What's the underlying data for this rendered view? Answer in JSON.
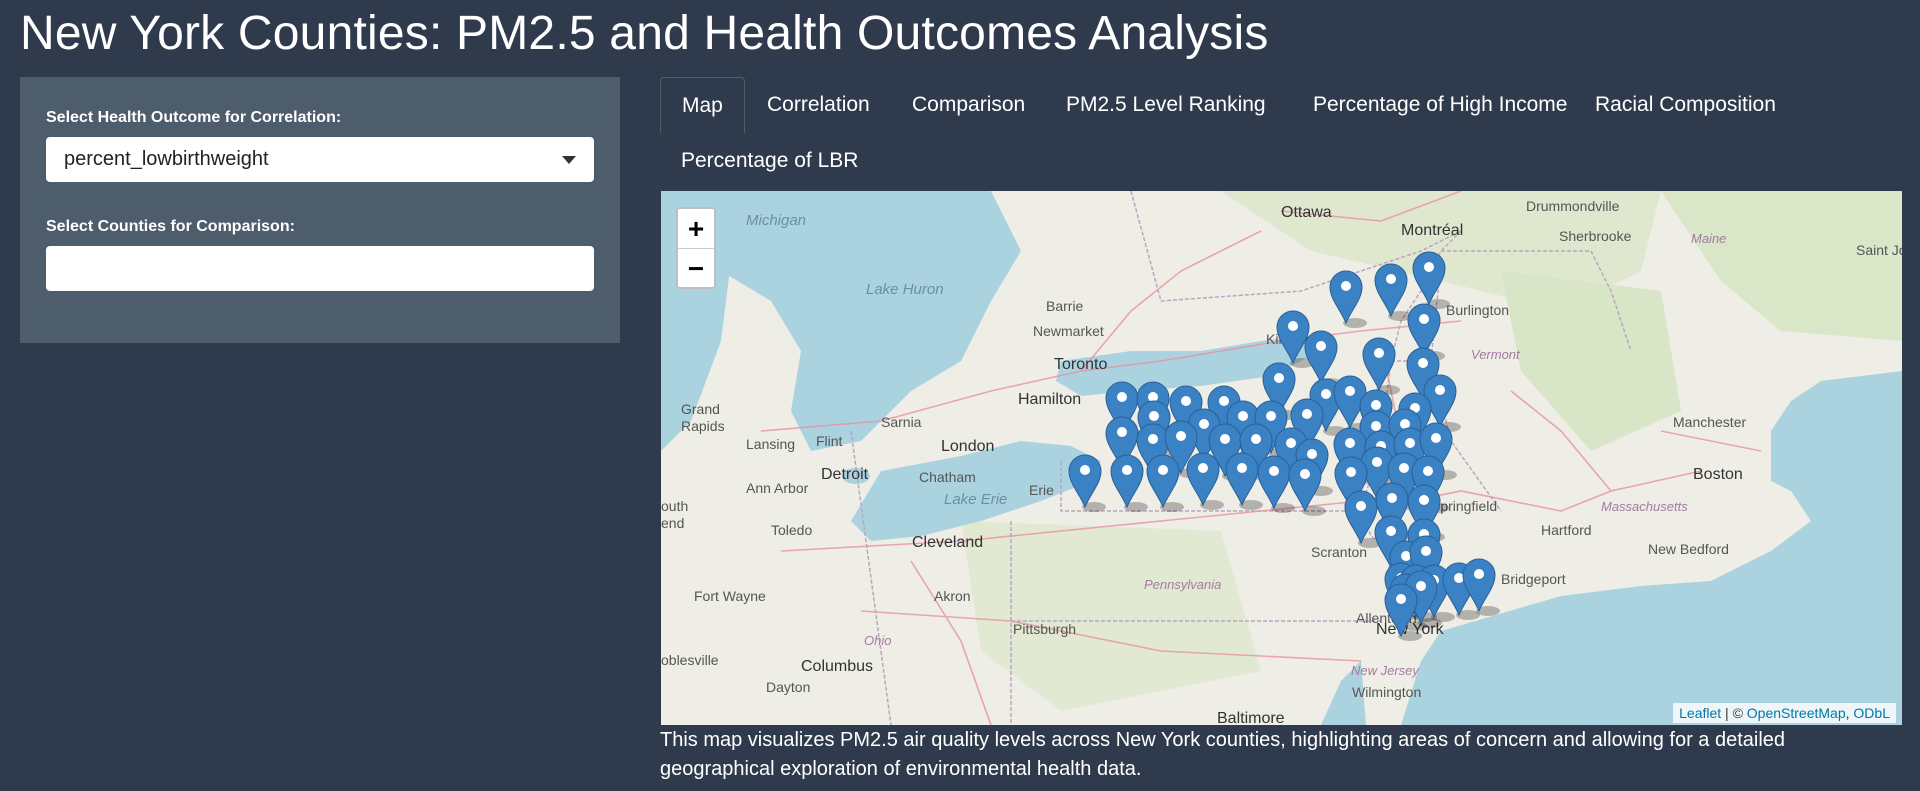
{
  "title": "New York Counties: PM2.5 and Health Outcomes Analysis",
  "sidebar": {
    "health_label": "Select Health Outcome for Correlation:",
    "health_value": "percent_lowbirthweight",
    "counties_label": "Select Counties for Comparison:",
    "counties_value": ""
  },
  "tabs": [
    "Map",
    "Correlation",
    "Comparison",
    "PM2.5 Level Ranking",
    "Percentage of High Income",
    "Racial Composition",
    "Percentage of LBR"
  ],
  "active_tab": "Map",
  "map": {
    "zoom_in": "+",
    "zoom_out": "−",
    "attribution_leaflet": "Leaflet",
    "attribution_sep1": " | © ",
    "attribution_osm": "OpenStreetMap",
    "attribution_sep2": ", ",
    "attribution_odbl": "ODbL",
    "marker_color": "#3b82c4",
    "labels": {
      "ottawa": "Ottawa",
      "montreal": "Montréal",
      "drummondville": "Drummondville",
      "sherbrooke": "Sherbrooke",
      "maine": "Maine",
      "saint_jo": "Saint Jo",
      "michigan": "Michigan",
      "lake_huron": "Lake Huron",
      "barrie": "Barrie",
      "newmarket": "Newmarket",
      "burlington": "Burlington",
      "kingston": "Kingston",
      "toronto": "Toronto",
      "vermont": "Vermont",
      "hamilton": "Hamilton",
      "grand_rapids_1": "Grand",
      "grand_rapids_2": "Rapids",
      "sarnia": "Sarnia",
      "flint": "Flint",
      "lansing": "Lansing",
      "london": "London",
      "manchester": "Manchester",
      "detroit": "Detroit",
      "chatham": "Chatham",
      "boston": "Boston",
      "ann_arbor": "Ann Arbor",
      "erie": "Erie",
      "lake_erie": "Lake Erie",
      "springfield": "Springfield",
      "massachusetts": "Massachusetts",
      "south_1": "outh",
      "south_2": "end",
      "toledo": "Toledo",
      "hartford": "Hartford",
      "cleveland": "Cleveland",
      "scranton": "Scranton",
      "new_bedford": "New Bedford",
      "bridgeport": "Bridgeport",
      "fort_wayne": "Fort Wayne",
      "akron": "Akron",
      "pennsylvania": "Pennsylvania",
      "ohio": "Ohio",
      "allentown": "Allentown",
      "new_york": "New York",
      "pittsburgh": "Pittsburgh",
      "bloomington": "oblesville",
      "columbus": "Columbus",
      "new_jersey": "New Jersey",
      "dayton": "Dayton",
      "wilmington": "Wilmington",
      "baltimore": "Baltimore"
    }
  },
  "caption": "This map visualizes PM2.5 air quality levels across New York counties, highlighting areas of concern and allowing for a detailed geographical exploration of environmental health data."
}
